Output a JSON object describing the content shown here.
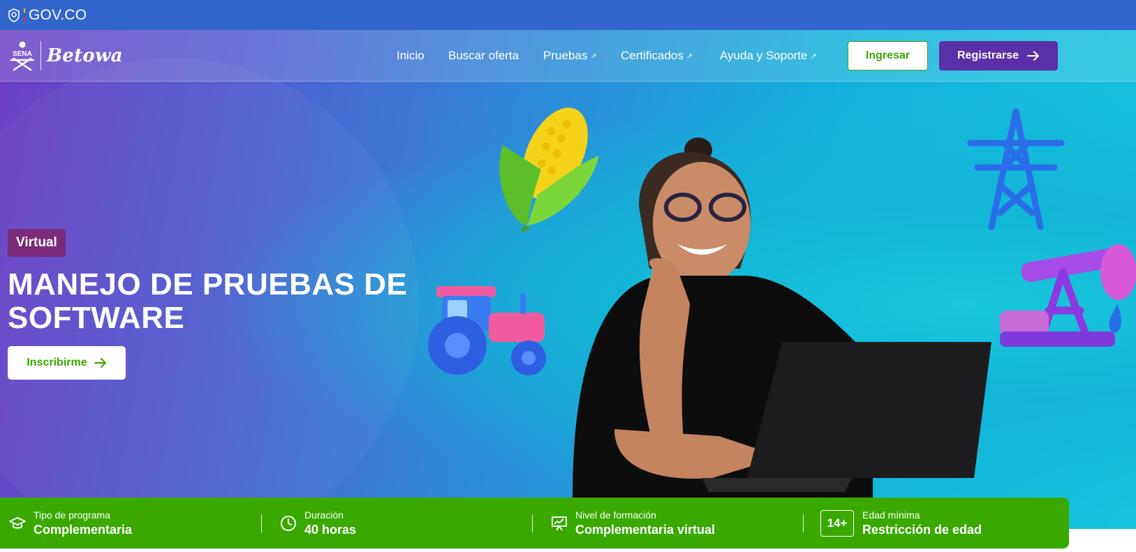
{
  "gov": {
    "logo_text": "GOV.CO"
  },
  "brand": {
    "org": "SENA",
    "name": "Betowa"
  },
  "nav": {
    "items": [
      {
        "label": "Inicio",
        "external": false
      },
      {
        "label": "Buscar oferta",
        "external": false
      },
      {
        "label": "Pruebas",
        "external": true
      },
      {
        "label": "Certificados",
        "external": true
      },
      {
        "label": "Ayuda y Soporte",
        "external": true
      }
    ],
    "login_label": "Ingresar",
    "register_label": "Registrarse"
  },
  "hero": {
    "modality": "Virtual",
    "title": "MANEJO DE PRUEBAS DE SOFTWARE",
    "cta_label": "Inscribirme"
  },
  "info": [
    {
      "label": "Tipo de programa",
      "value": "Complementaria",
      "icon": "graduation-cap-icon"
    },
    {
      "label": "Duración",
      "value": "40 horas",
      "icon": "clock-icon"
    },
    {
      "label": "Nivel de formación",
      "value": "Complementaria virtual",
      "icon": "presentation-chart-icon"
    },
    {
      "label": "Edad mínima",
      "value": "Restricción de edad",
      "badge": "14+",
      "icon": "age-badge-icon"
    }
  ],
  "colors": {
    "green": "#39a900",
    "purple": "#5b2fa6",
    "gov_blue": "#3366cc",
    "badge": "#7a2b79"
  }
}
